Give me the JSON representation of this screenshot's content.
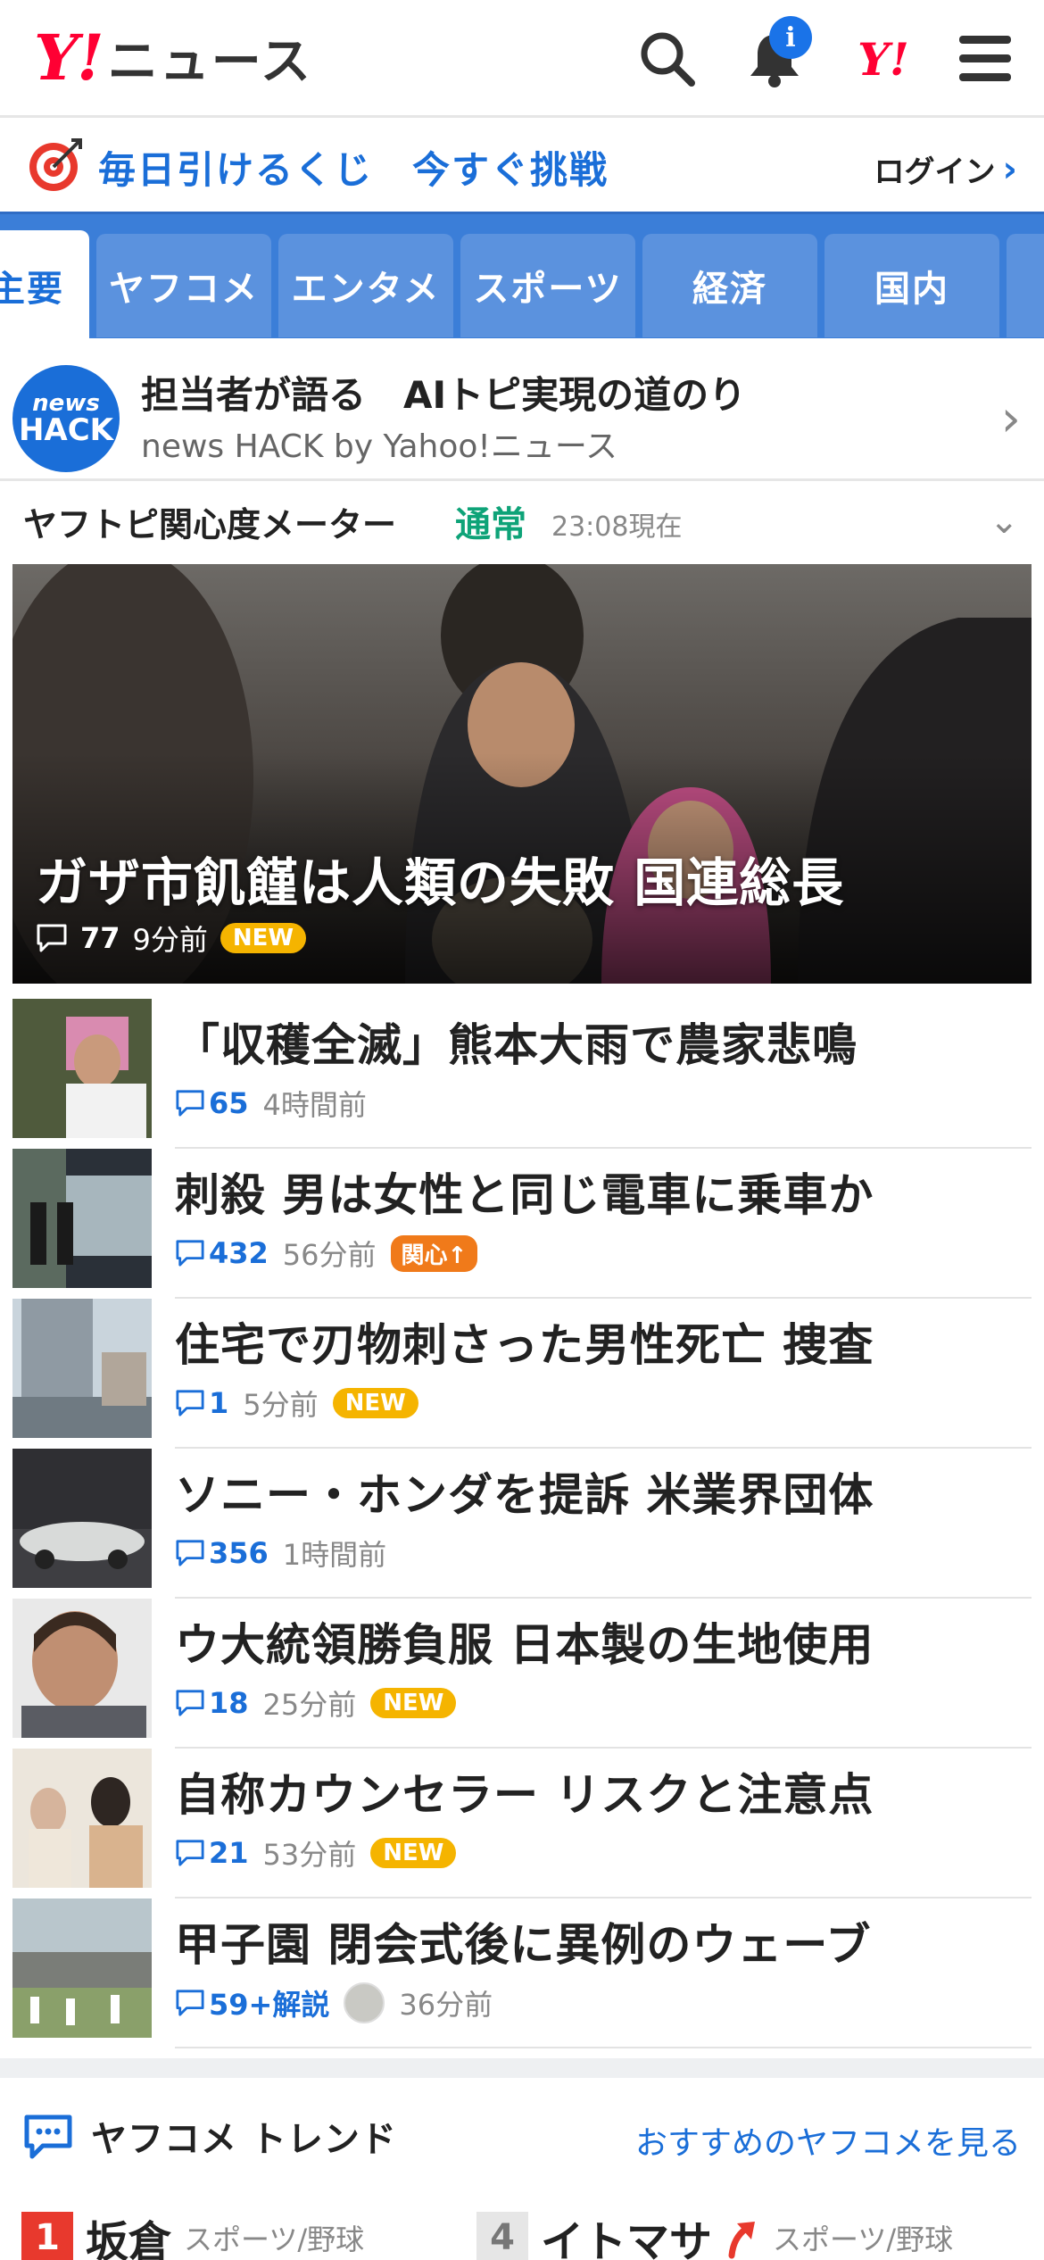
{
  "header": {
    "logo_y": "Y!",
    "logo_text": "ニュース",
    "notification_count": "i",
    "yj_logo": "Y!"
  },
  "lottery": {
    "text": "毎日引けるくじ　今すぐ挑戦",
    "login": "ログイン"
  },
  "tabs": [
    {
      "label": "主要",
      "active": true
    },
    {
      "label": "ヤフコメ",
      "active": false
    },
    {
      "label": "エンタメ",
      "active": false
    },
    {
      "label": "スポーツ",
      "active": false
    },
    {
      "label": "経済",
      "active": false
    },
    {
      "label": "国内",
      "active": false
    }
  ],
  "promo": {
    "logo_top": "news",
    "logo_bottom": "HACK",
    "title": "担当者が語る　AIトピ実現の道のり",
    "subtitle": "news HACK by Yahoo!ニュース"
  },
  "meter": {
    "title": "ヤフトピ関心度メーター",
    "status": "通常",
    "time": "23:08現在"
  },
  "hero": {
    "title": "ガザ市飢饉は人類の失敗 国連総長",
    "comments": "77",
    "time": "9分前",
    "badge": "NEW"
  },
  "articles": [
    {
      "title": "「収穫全滅」熊本大雨で農家悲鳴",
      "comments": "65",
      "time": "4時間前",
      "badge": ""
    },
    {
      "title": "刺殺 男は女性と同じ電車に乗車か",
      "comments": "432",
      "time": "56分前",
      "badge": "関心↑"
    },
    {
      "title": "住宅で刃物刺さった男性死亡 捜査",
      "comments": "1",
      "time": "5分前",
      "badge": "NEW"
    },
    {
      "title": "ソニー・ホンダを提訴 米業界団体",
      "comments": "356",
      "time": "1時間前",
      "badge": ""
    },
    {
      "title": "ウ大統領勝負服 日本製の生地使用",
      "comments": "18",
      "time": "25分前",
      "badge": "NEW"
    },
    {
      "title": "自称カウンセラー リスクと注意点",
      "comments": "21",
      "time": "53分前",
      "badge": "NEW"
    },
    {
      "title": "甲子園 閉会式後に異例のウェーブ",
      "comments": "59+解説",
      "time": "36分前",
      "badge": ""
    }
  ],
  "trend": {
    "title": "ヤフコメ トレンド",
    "link": "おすすめのヤフコメを見る",
    "ranks": [
      {
        "num": "1",
        "name": "坂倉",
        "category": "スポーツ/野球",
        "color": "#e8392d"
      },
      {
        "num": "4",
        "name": "イトマサ",
        "category": "スポーツ/野球",
        "color": "#777777"
      }
    ]
  },
  "colors": {
    "brand_red": "#ff0033",
    "link_blue": "#1a6ed8",
    "tab_bar": "#3b7ed8",
    "new_badge": "#f5b400",
    "meter_green": "#0ea378"
  }
}
